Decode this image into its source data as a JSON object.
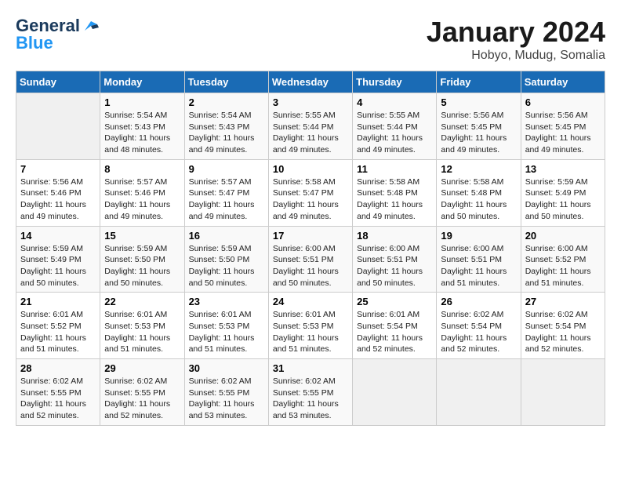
{
  "logo": {
    "line1": "General",
    "line2": "Blue"
  },
  "title": "January 2024",
  "subtitle": "Hobyo, Mudug, Somalia",
  "columns": [
    "Sunday",
    "Monday",
    "Tuesday",
    "Wednesday",
    "Thursday",
    "Friday",
    "Saturday"
  ],
  "weeks": [
    [
      {
        "num": "",
        "info": ""
      },
      {
        "num": "1",
        "info": "Sunrise: 5:54 AM\nSunset: 5:43 PM\nDaylight: 11 hours\nand 48 minutes."
      },
      {
        "num": "2",
        "info": "Sunrise: 5:54 AM\nSunset: 5:43 PM\nDaylight: 11 hours\nand 49 minutes."
      },
      {
        "num": "3",
        "info": "Sunrise: 5:55 AM\nSunset: 5:44 PM\nDaylight: 11 hours\nand 49 minutes."
      },
      {
        "num": "4",
        "info": "Sunrise: 5:55 AM\nSunset: 5:44 PM\nDaylight: 11 hours\nand 49 minutes."
      },
      {
        "num": "5",
        "info": "Sunrise: 5:56 AM\nSunset: 5:45 PM\nDaylight: 11 hours\nand 49 minutes."
      },
      {
        "num": "6",
        "info": "Sunrise: 5:56 AM\nSunset: 5:45 PM\nDaylight: 11 hours\nand 49 minutes."
      }
    ],
    [
      {
        "num": "7",
        "info": "Sunrise: 5:56 AM\nSunset: 5:46 PM\nDaylight: 11 hours\nand 49 minutes."
      },
      {
        "num": "8",
        "info": "Sunrise: 5:57 AM\nSunset: 5:46 PM\nDaylight: 11 hours\nand 49 minutes."
      },
      {
        "num": "9",
        "info": "Sunrise: 5:57 AM\nSunset: 5:47 PM\nDaylight: 11 hours\nand 49 minutes."
      },
      {
        "num": "10",
        "info": "Sunrise: 5:58 AM\nSunset: 5:47 PM\nDaylight: 11 hours\nand 49 minutes."
      },
      {
        "num": "11",
        "info": "Sunrise: 5:58 AM\nSunset: 5:48 PM\nDaylight: 11 hours\nand 49 minutes."
      },
      {
        "num": "12",
        "info": "Sunrise: 5:58 AM\nSunset: 5:48 PM\nDaylight: 11 hours\nand 50 minutes."
      },
      {
        "num": "13",
        "info": "Sunrise: 5:59 AM\nSunset: 5:49 PM\nDaylight: 11 hours\nand 50 minutes."
      }
    ],
    [
      {
        "num": "14",
        "info": "Sunrise: 5:59 AM\nSunset: 5:49 PM\nDaylight: 11 hours\nand 50 minutes."
      },
      {
        "num": "15",
        "info": "Sunrise: 5:59 AM\nSunset: 5:50 PM\nDaylight: 11 hours\nand 50 minutes."
      },
      {
        "num": "16",
        "info": "Sunrise: 5:59 AM\nSunset: 5:50 PM\nDaylight: 11 hours\nand 50 minutes."
      },
      {
        "num": "17",
        "info": "Sunrise: 6:00 AM\nSunset: 5:51 PM\nDaylight: 11 hours\nand 50 minutes."
      },
      {
        "num": "18",
        "info": "Sunrise: 6:00 AM\nSunset: 5:51 PM\nDaylight: 11 hours\nand 50 minutes."
      },
      {
        "num": "19",
        "info": "Sunrise: 6:00 AM\nSunset: 5:51 PM\nDaylight: 11 hours\nand 51 minutes."
      },
      {
        "num": "20",
        "info": "Sunrise: 6:00 AM\nSunset: 5:52 PM\nDaylight: 11 hours\nand 51 minutes."
      }
    ],
    [
      {
        "num": "21",
        "info": "Sunrise: 6:01 AM\nSunset: 5:52 PM\nDaylight: 11 hours\nand 51 minutes."
      },
      {
        "num": "22",
        "info": "Sunrise: 6:01 AM\nSunset: 5:53 PM\nDaylight: 11 hours\nand 51 minutes."
      },
      {
        "num": "23",
        "info": "Sunrise: 6:01 AM\nSunset: 5:53 PM\nDaylight: 11 hours\nand 51 minutes."
      },
      {
        "num": "24",
        "info": "Sunrise: 6:01 AM\nSunset: 5:53 PM\nDaylight: 11 hours\nand 51 minutes."
      },
      {
        "num": "25",
        "info": "Sunrise: 6:01 AM\nSunset: 5:54 PM\nDaylight: 11 hours\nand 52 minutes."
      },
      {
        "num": "26",
        "info": "Sunrise: 6:02 AM\nSunset: 5:54 PM\nDaylight: 11 hours\nand 52 minutes."
      },
      {
        "num": "27",
        "info": "Sunrise: 6:02 AM\nSunset: 5:54 PM\nDaylight: 11 hours\nand 52 minutes."
      }
    ],
    [
      {
        "num": "28",
        "info": "Sunrise: 6:02 AM\nSunset: 5:55 PM\nDaylight: 11 hours\nand 52 minutes."
      },
      {
        "num": "29",
        "info": "Sunrise: 6:02 AM\nSunset: 5:55 PM\nDaylight: 11 hours\nand 52 minutes."
      },
      {
        "num": "30",
        "info": "Sunrise: 6:02 AM\nSunset: 5:55 PM\nDaylight: 11 hours\nand 53 minutes."
      },
      {
        "num": "31",
        "info": "Sunrise: 6:02 AM\nSunset: 5:55 PM\nDaylight: 11 hours\nand 53 minutes."
      },
      {
        "num": "",
        "info": ""
      },
      {
        "num": "",
        "info": ""
      },
      {
        "num": "",
        "info": ""
      }
    ]
  ]
}
